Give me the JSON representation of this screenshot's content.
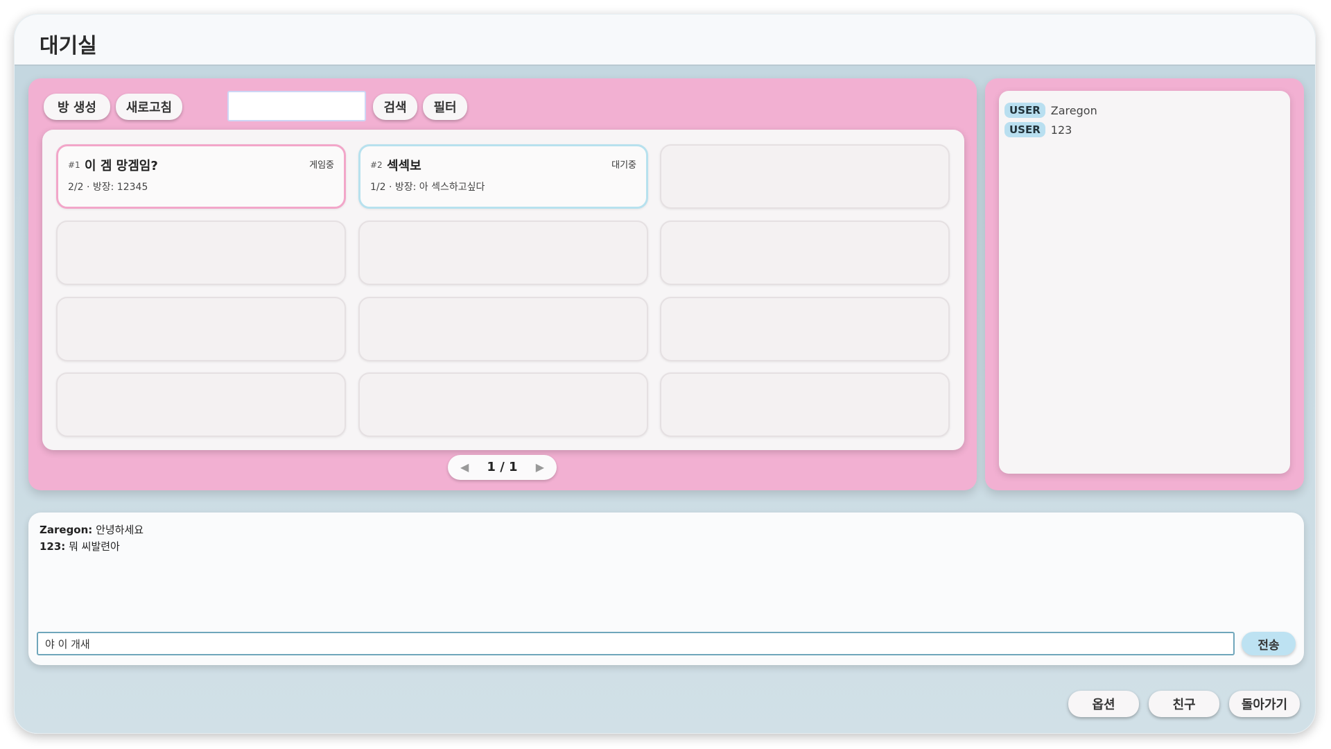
{
  "window": {
    "title": "대기실"
  },
  "toolbar": {
    "create_room": "방 생성",
    "refresh": "새로고침",
    "search_value": "",
    "search": "검색",
    "filter": "필터"
  },
  "rooms": [
    {
      "number": "#1",
      "title": "이 겜 망겜임?",
      "status": "게임중",
      "info": "2/2 · 방장: 12345"
    },
    {
      "number": "#2",
      "title": "섹섹보",
      "status": "대기중",
      "info": "1/2 · 방장: 아 섹스하고싶다"
    }
  ],
  "pager": {
    "label": "1 / 1",
    "prev_icon": "◀",
    "next_icon": "▶"
  },
  "users": [
    {
      "badge": "USER",
      "name": "Zaregon"
    },
    {
      "badge": "USER",
      "name": "123"
    }
  ],
  "chat": {
    "messages": [
      {
        "user": "Zaregon:",
        "text": "안녕하세요"
      },
      {
        "user": "123:",
        "text": "뭐 씨발련아"
      }
    ],
    "input_value": "야 이 개새",
    "send": "전송"
  },
  "footer": {
    "options": "옵션",
    "friends": "친구",
    "back": "돌아가기"
  }
}
